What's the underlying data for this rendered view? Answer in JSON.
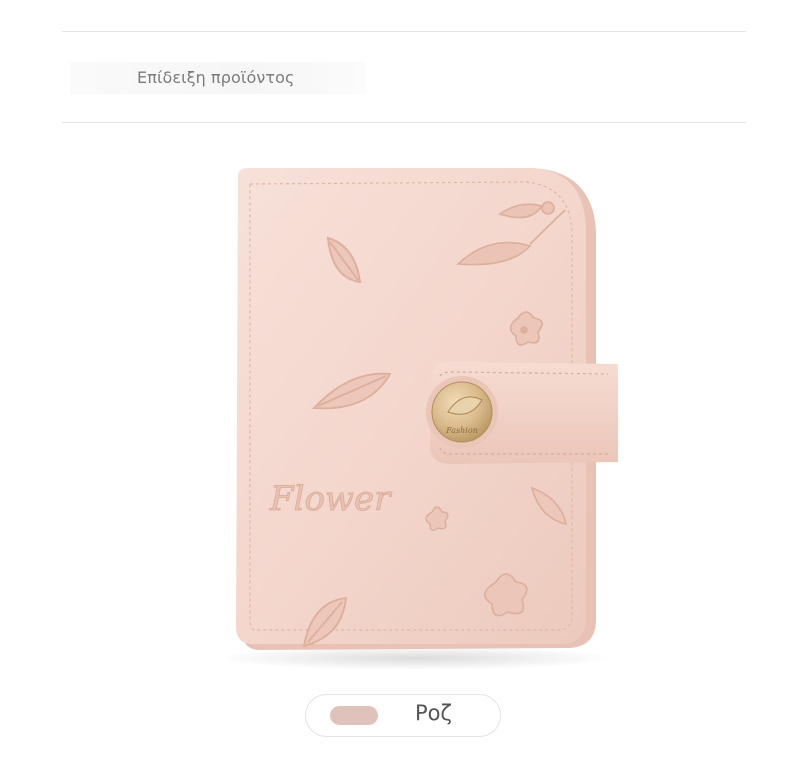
{
  "section": {
    "heading": "Επίδειξη προϊόντος"
  },
  "product": {
    "image_icon": "pink-leather-card-wallet-icon",
    "embossed_text": "Flower",
    "button_text": "Fashion"
  },
  "color_option": {
    "label": "Ροζ",
    "swatch_color": "#dfc3ba",
    "selected": true
  },
  "colors": {
    "wallet_body": "#f3d6cc",
    "wallet_edge": "#e6bfb2",
    "button_gold": "#d9b98a"
  }
}
